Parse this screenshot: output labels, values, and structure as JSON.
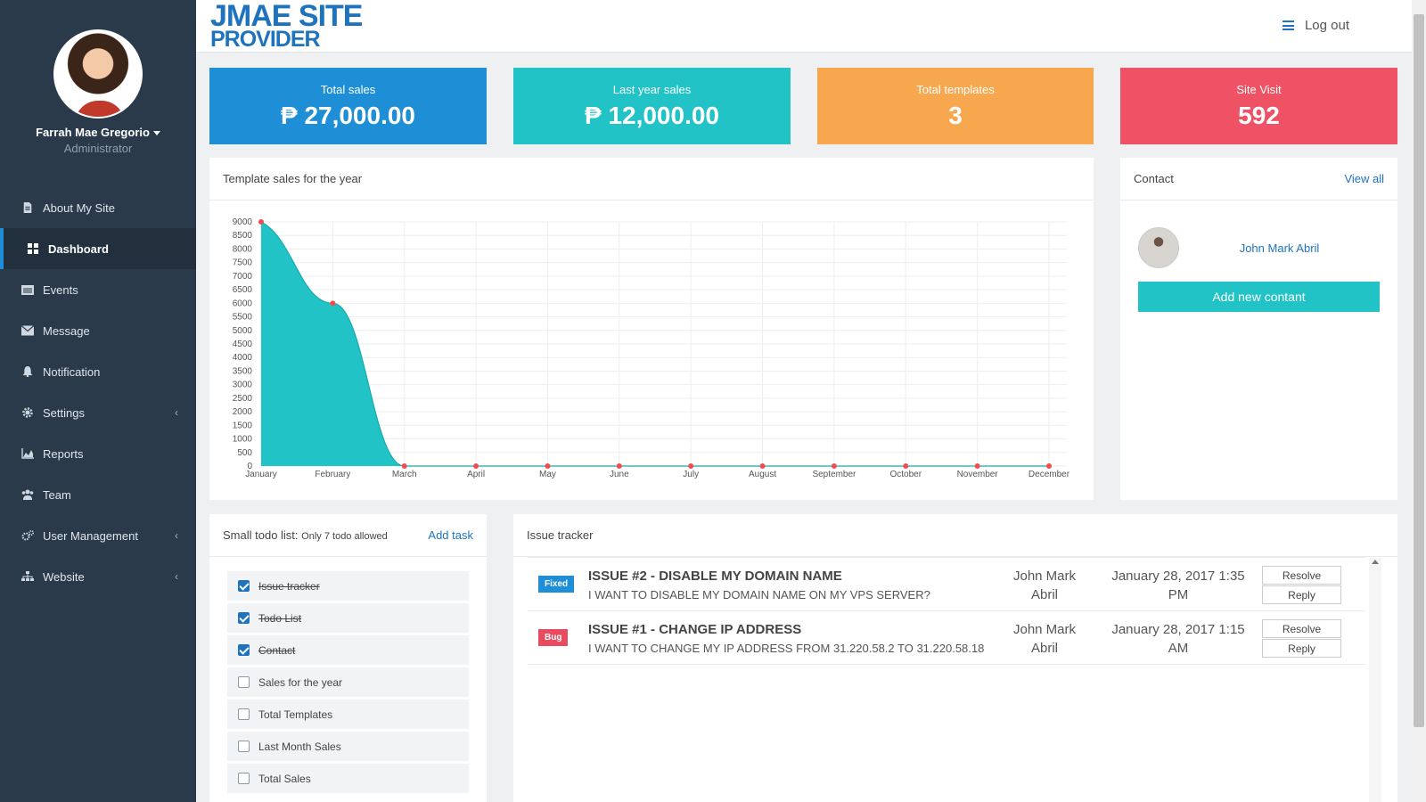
{
  "header": {
    "logo_line1": "JMAE SITE",
    "logo_line2": "PROVIDER",
    "logout_label": "Log out"
  },
  "profile": {
    "name": "Farrah Mae Gregorio",
    "role": "Administrator"
  },
  "sidebar": {
    "items": [
      {
        "label": "About My Site",
        "icon": "file-icon"
      },
      {
        "label": "Dashboard",
        "icon": "dashboard-icon",
        "active": true
      },
      {
        "label": "Events",
        "icon": "calendar-icon"
      },
      {
        "label": "Message",
        "icon": "envelope-icon"
      },
      {
        "label": "Notification",
        "icon": "bell-icon"
      },
      {
        "label": "Settings",
        "icon": "gear-icon",
        "chevron": true
      },
      {
        "label": "Reports",
        "icon": "area-chart-icon"
      },
      {
        "label": "Team",
        "icon": "users-icon"
      },
      {
        "label": "User Management",
        "icon": "cogs-icon",
        "chevron": true
      },
      {
        "label": "Website",
        "icon": "sitemap-icon",
        "chevron": true
      }
    ]
  },
  "stats": [
    {
      "label": "Total sales",
      "value": "₱ 27,000.00",
      "color": "#1e8fd6"
    },
    {
      "label": "Last year sales",
      "value": "₱ 12,000.00",
      "color": "#22c3c6"
    },
    {
      "label": "Total templates",
      "value": "3",
      "color": "#f7a84f"
    },
    {
      "label": "Site Visit",
      "value": "592",
      "color": "#ee5264"
    }
  ],
  "chart_panel": {
    "title": "Template sales for the year"
  },
  "chart_data": {
    "type": "area",
    "categories": [
      "January",
      "February",
      "March",
      "April",
      "May",
      "June",
      "July",
      "August",
      "September",
      "October",
      "November",
      "December"
    ],
    "values": [
      9000,
      6000,
      0,
      0,
      0,
      0,
      0,
      0,
      0,
      0,
      0,
      0
    ],
    "yticks": [
      0,
      500,
      1000,
      1500,
      2000,
      2500,
      3000,
      3500,
      4000,
      4500,
      5000,
      5500,
      6000,
      6500,
      7000,
      7500,
      8000,
      8500,
      9000
    ],
    "ylim": [
      0,
      9000
    ],
    "fill_color": "#22c3c6",
    "point_color": "#f04e4e",
    "grid": true
  },
  "contact": {
    "title": "Contact",
    "view_all": "View all",
    "person": "John Mark Abril",
    "add_label": "Add new contant"
  },
  "todo": {
    "title": "Small todo list:",
    "subtitle": "Only 7 todo allowed",
    "add_label": "Add task",
    "items": [
      {
        "label": "Issue tracker",
        "done": true
      },
      {
        "label": "Todo List",
        "done": true
      },
      {
        "label": "Contact",
        "done": true
      },
      {
        "label": "Sales for the year",
        "done": false
      },
      {
        "label": "Total Templates",
        "done": false
      },
      {
        "label": "Last Month Sales",
        "done": false
      },
      {
        "label": "Total Sales",
        "done": false
      }
    ]
  },
  "issues": {
    "title": "Issue tracker",
    "resolve_label": "Resolve",
    "reply_label": "Reply",
    "items": [
      {
        "badge": "Fixed",
        "title": "ISSUE #2 - DISABLE MY DOMAIN NAME",
        "desc": "I WANT TO DISABLE MY DOMAIN NAME ON MY VPS SERVER?",
        "author": "John Mark Abril",
        "date": "January 28, 2017 1:35 PM"
      },
      {
        "badge": "Bug",
        "title": "ISSUE #1 - CHANGE IP ADDRESS",
        "desc": "I WANT TO CHANGE MY IP ADDRESS FROM 31.220.58.2 TO 31.220.58.18",
        "author": "John Mark Abril",
        "date": "January 28, 2017 1:15 AM"
      }
    ]
  }
}
